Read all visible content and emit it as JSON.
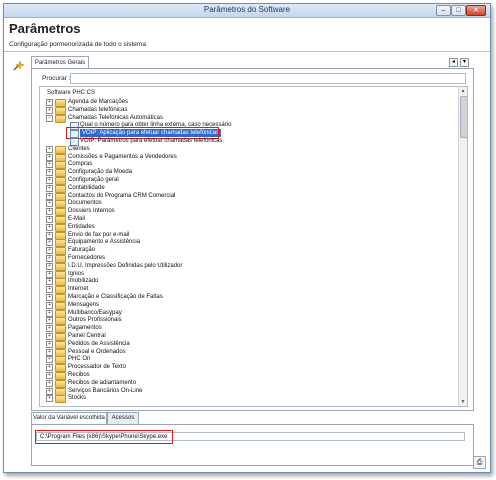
{
  "window": {
    "title": "Parâmetros do Software"
  },
  "header": {
    "title": "Parâmetros",
    "subtitle": "Configuração pormenorizada de todo o sistema"
  },
  "tabs": {
    "general": "Parâmetros Gerais"
  },
  "search": {
    "label": "Procurar :",
    "value": ""
  },
  "tree": {
    "root": "Software PHC CS",
    "items": [
      {
        "label": "Agenda de Marcações",
        "type": "folder",
        "expanded": false
      },
      {
        "label": "Chamadas telefónicas",
        "type": "folder",
        "expanded": false
      },
      {
        "label": "Chamadas Telefónicas Automáticas",
        "type": "folder",
        "expanded": true
      },
      {
        "label": "Qual o número para obter linha externa, caso necessário",
        "type": "leaf",
        "expanded": false
      },
      {
        "label": "VOIP: Aplicação para efetuar chamadas telefónicas",
        "type": "leaf",
        "expanded": false,
        "selected": true
      },
      {
        "label": "VOIP: Parâmetros para efetuar chamadas telefónicas",
        "type": "leaf",
        "expanded": false
      },
      {
        "label": "Clientes",
        "type": "folder",
        "expanded": false
      },
      {
        "label": "Comissões e Pagamentos a Vendedores",
        "type": "folder",
        "expanded": false
      },
      {
        "label": "Compras",
        "type": "folder",
        "expanded": false
      },
      {
        "label": "Configuração da Moeda",
        "type": "folder",
        "expanded": false
      },
      {
        "label": "Configuração geral",
        "type": "folder",
        "expanded": false
      },
      {
        "label": "Contabilidade",
        "type": "folder",
        "expanded": false
      },
      {
        "label": "Contactos do Programa CRM Comercial",
        "type": "folder",
        "expanded": false
      },
      {
        "label": "Documentos",
        "type": "folder",
        "expanded": false
      },
      {
        "label": "Dossiers Internos",
        "type": "folder",
        "expanded": false
      },
      {
        "label": "E-Mail",
        "type": "folder",
        "expanded": false
      },
      {
        "label": "Entidades",
        "type": "folder",
        "expanded": false
      },
      {
        "label": "Envio de fax por e-mail",
        "type": "folder",
        "expanded": false
      },
      {
        "label": "Equipamento e Assistência",
        "type": "folder",
        "expanded": false
      },
      {
        "label": "Faturação",
        "type": "folder",
        "expanded": false
      },
      {
        "label": "Fornecedores",
        "type": "folder",
        "expanded": false
      },
      {
        "label": "I.D.U. Impressões Definidas pelo Utilizador",
        "type": "folder",
        "expanded": false
      },
      {
        "label": "Ignios",
        "type": "folder",
        "expanded": false
      },
      {
        "label": "Imobilizado",
        "type": "folder",
        "expanded": false
      },
      {
        "label": "Internet",
        "type": "folder",
        "expanded": false
      },
      {
        "label": "Marcação e Classificação de Faltas",
        "type": "folder",
        "expanded": false
      },
      {
        "label": "Mensagens",
        "type": "folder",
        "expanded": false
      },
      {
        "label": "Multibanco/Easypay",
        "type": "folder",
        "expanded": false
      },
      {
        "label": "Outros Profissionais",
        "type": "folder",
        "expanded": false
      },
      {
        "label": "Pagamentos",
        "type": "folder",
        "expanded": false
      },
      {
        "label": "Painel Central",
        "type": "folder",
        "expanded": false
      },
      {
        "label": "Pedidos de Assistência",
        "type": "folder",
        "expanded": false
      },
      {
        "label": "Pessoal e Ordenados",
        "type": "folder",
        "expanded": false
      },
      {
        "label": "PHC On",
        "type": "folder",
        "expanded": false
      },
      {
        "label": "Processador de Texto",
        "type": "folder",
        "expanded": false
      },
      {
        "label": "Recibos",
        "type": "folder",
        "expanded": false
      },
      {
        "label": "Recibos de adiantamento",
        "type": "folder",
        "expanded": false
      },
      {
        "label": "Serviços Bancários On-Line",
        "type": "folder",
        "expanded": false
      },
      {
        "label": "Stocks",
        "type": "folder",
        "expanded": false
      }
    ]
  },
  "bottom": {
    "tabs": [
      "Valor da Variável escolhida",
      "Acessos"
    ],
    "value": "C:\\Program Files (x86)\\Skype\\Phone\\Skype.exe"
  },
  "colors": {
    "selection": "#2f6acb",
    "highlight": "#e8161b"
  }
}
